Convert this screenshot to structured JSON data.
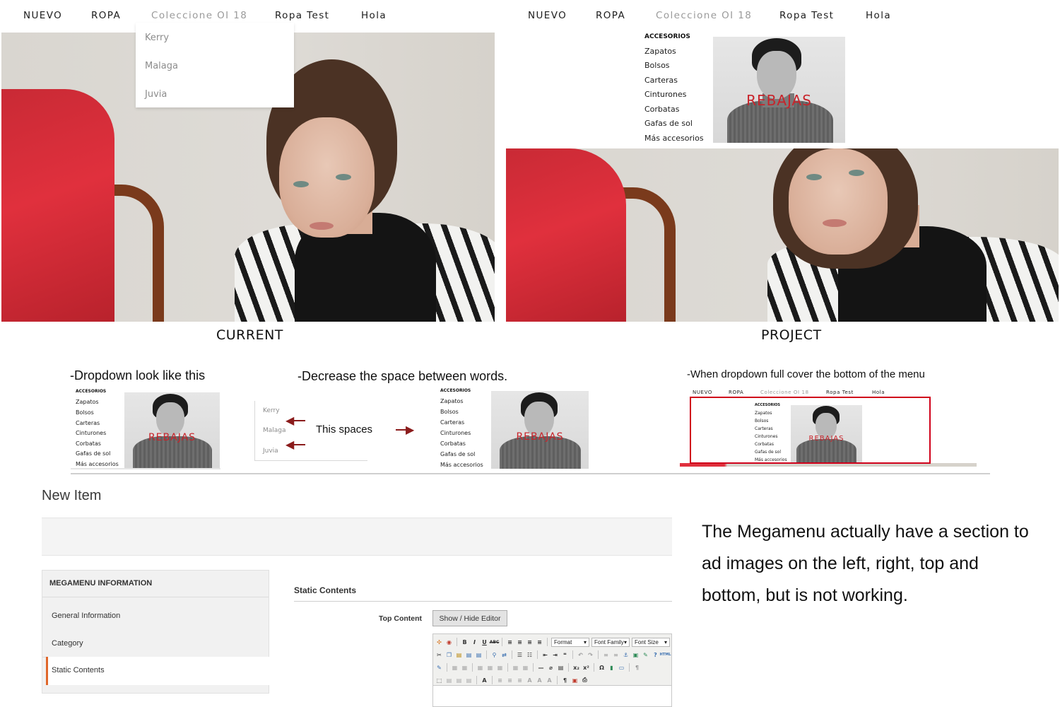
{
  "nav": {
    "items": [
      "NUEVO",
      "ROPA",
      "Coleccione OI 18",
      "Ropa Test",
      "Hola"
    ]
  },
  "dropdown": {
    "items": [
      "Kerry",
      "Malaga",
      "Juvia"
    ]
  },
  "megamenu": {
    "heading": "ACCESORIOS",
    "items": [
      "Zapatos",
      "Bolsos",
      "Carteras",
      "Cinturones",
      "Corbatas",
      "Gafas de sol",
      "Más accesorios"
    ],
    "promo_text": "REBAJAS"
  },
  "captions": {
    "current": "CURRENT",
    "project": "PROJECT"
  },
  "notes": {
    "dropdown_look": "-Dropdown look like this",
    "decrease_space": "-Decrease the space between words.",
    "this_spaces": "This spaces",
    "full_cover": "-When dropdown full cover the bottom of the menu"
  },
  "admin": {
    "page_title": "New Item",
    "sidebar_heading": "MEGAMENU INFORMATION",
    "sidebar_items": [
      "General Information",
      "Category",
      "Static Contents"
    ],
    "section_heading": "Static Contents",
    "field_label": "Top Content",
    "toggle_button": "Show / Hide Editor",
    "editor_selects": [
      "Format",
      "Font Family",
      "Font Size"
    ]
  },
  "big_note": "The Megamenu actually have a section to ad images on the left, right, top and bottom, but is not working.",
  "colors": {
    "accent_red": "#c8232a",
    "annotation_red": "#d0021b",
    "active_tab_orange": "#e0672b"
  }
}
